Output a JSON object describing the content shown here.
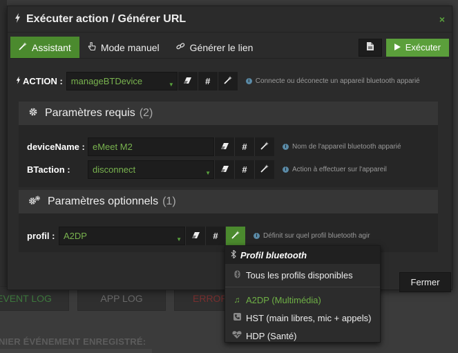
{
  "modal": {
    "title": "Exécuter action / Générer URL",
    "close": "×"
  },
  "tabs": [
    {
      "label": "Assistant",
      "icon": "magic-wand-icon",
      "active": true
    },
    {
      "label": "Mode manuel",
      "icon": "hand-pointer-icon",
      "active": false
    },
    {
      "label": "Générer le lien",
      "icon": "link-icon",
      "active": false
    }
  ],
  "toolbar": {
    "execute_label": "Exécuter"
  },
  "action": {
    "label": "ACTION :",
    "value": "manageBTDevice",
    "hint": "Connecte ou déconecte un appareil bluetooth apparié"
  },
  "required_params": {
    "title": "Paramètres requis",
    "count": "(2)",
    "params": [
      {
        "label": "deviceName :",
        "value": "eMeet M2",
        "hint": "Nom de l'appareil bluetooth apparié"
      },
      {
        "label": "BTaction :",
        "value": "disconnect",
        "hint": "Action à effectuer sur l'appareil"
      }
    ]
  },
  "optional_params": {
    "title": "Paramètres optionnels",
    "count": "(1)",
    "params": [
      {
        "label": "profil :",
        "value": "A2DP",
        "hint": "Définit sur quel profil bluetooth agir"
      }
    ]
  },
  "profile_menu": {
    "header": "Profil bluetooth",
    "all_label": "Tous les profils disponibles",
    "items": [
      {
        "label": "A2DP (Multimédia)",
        "icon": "music-note-icon",
        "selected": true
      },
      {
        "label": "HST (main libres, mic + appels)",
        "icon": "phone-icon",
        "selected": false
      },
      {
        "label": "HDP (Santé)",
        "icon": "heartbeat-icon",
        "selected": false
      }
    ]
  },
  "footer": {
    "close_label": "Fermer"
  },
  "background": {
    "tabs": [
      "EVENT LOG",
      "APP LOG",
      "ERROR"
    ],
    "caption": "NIER ÉVÉNEMENT ENREGISTRÉ:"
  },
  "colors": {
    "accent": "#4b8a2e",
    "accent_text": "#79b34f",
    "panel_head": "#363636",
    "input_bg": "#1d1d1d"
  }
}
